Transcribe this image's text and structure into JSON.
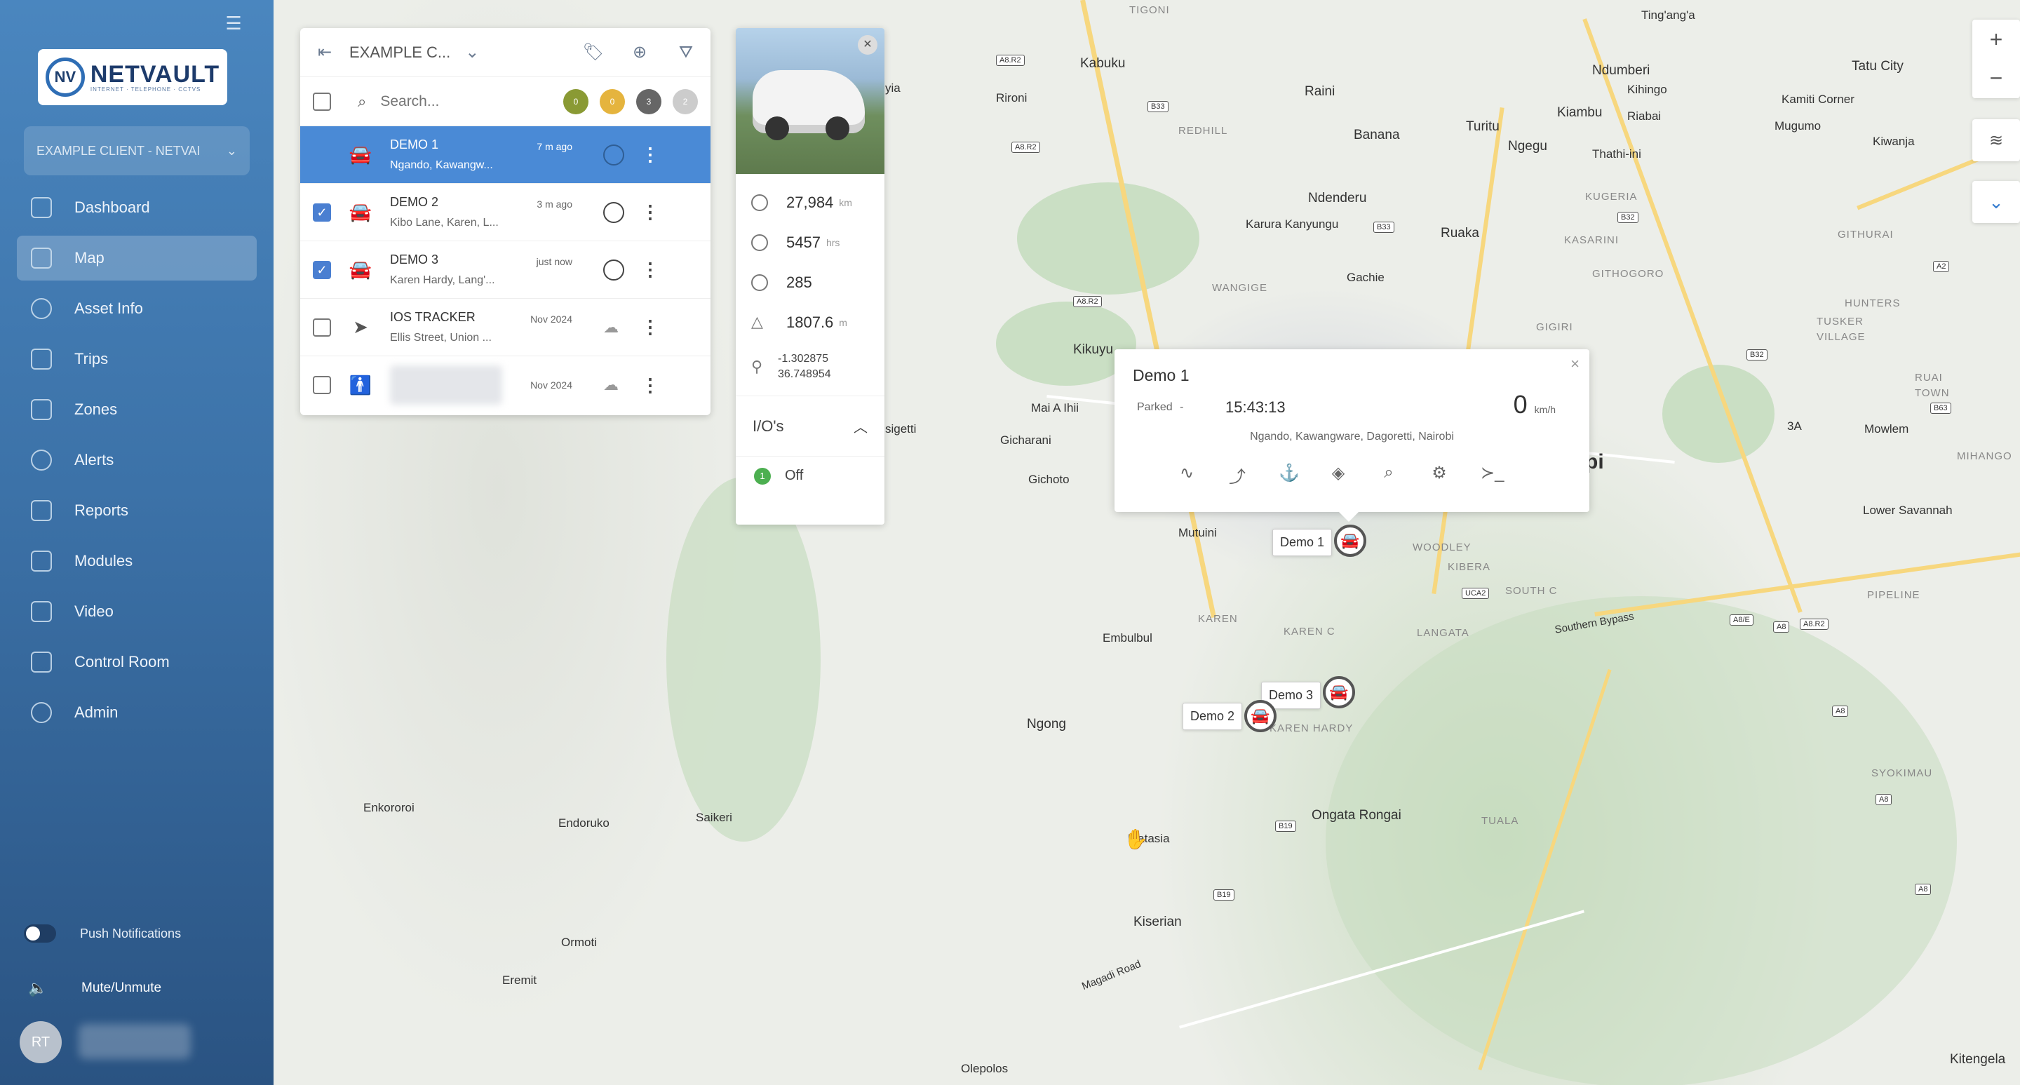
{
  "sidebar": {
    "logo_text": "NETVAULT",
    "logo_sub": "INTERNET · TELEPHONE · CCTVS",
    "client_select": "EXAMPLE CLIENT - NETVAI",
    "nav": [
      {
        "label": "Dashboard",
        "icon": "chart-line-icon"
      },
      {
        "label": "Map",
        "icon": "navigation-arrow-icon",
        "active": true
      },
      {
        "label": "Asset Info",
        "icon": "info-circle-icon"
      },
      {
        "label": "Trips",
        "icon": "route-icon"
      },
      {
        "label": "Zones",
        "icon": "zone-map-icon"
      },
      {
        "label": "Alerts",
        "icon": "bell-icon"
      },
      {
        "label": "Reports",
        "icon": "document-icon"
      },
      {
        "label": "Modules",
        "icon": "modules-icon"
      },
      {
        "label": "Video",
        "icon": "video-camera-icon"
      },
      {
        "label": "Control Room",
        "icon": "control-room-icon"
      },
      {
        "label": "Admin",
        "icon": "gear-icon"
      }
    ],
    "push_notifications": "Push Notifications",
    "mute_unmute": "Mute/Unmute",
    "avatar_initials": "RT"
  },
  "list_panel": {
    "title": "EXAMPLE C...",
    "search_placeholder": "Search...",
    "status_counts": [
      {
        "value": "0",
        "color": "#8a9a34"
      },
      {
        "value": "0",
        "color": "#e5b43e"
      },
      {
        "value": "3",
        "color": "#666666"
      },
      {
        "value": "2",
        "color": "#cccccc"
      }
    ],
    "rows": [
      {
        "name": "DEMO 1",
        "address": "Ngando, Kawangw...",
        "time": "7 m ago",
        "selected": true,
        "checked": false,
        "icon": "car-icon",
        "status": "ring"
      },
      {
        "name": "DEMO 2",
        "address": "Kibo Lane, Karen, L...",
        "time": "3 m ago",
        "selected": false,
        "checked": true,
        "icon": "car-icon",
        "status": "ring"
      },
      {
        "name": "DEMO 3",
        "address": "Karen Hardy, Lang'...",
        "time": "just now",
        "selected": false,
        "checked": true,
        "icon": "car-icon",
        "status": "ring"
      },
      {
        "name": "IOS TRACKER",
        "address": "Ellis Street, Union ...",
        "time": "Nov 2024",
        "selected": false,
        "checked": false,
        "icon": "navigation-icon",
        "status": "cloud"
      },
      {
        "name": "",
        "address": "",
        "time": "Nov 2024",
        "selected": false,
        "checked": false,
        "icon": "person-icon",
        "status": "cloud",
        "blurred": true
      }
    ]
  },
  "detail": {
    "odometer": "27,984",
    "odometer_unit": "km",
    "engine_hours": "5457",
    "engine_unit": "hrs",
    "heading": "285",
    "altitude": "1807.6",
    "altitude_unit": "m",
    "lat": "-1.302875",
    "lng": "36.748954",
    "io_title": "I/O's",
    "io_badge": "1",
    "io_value": "Off"
  },
  "popup": {
    "title": "Demo 1",
    "status": "Parked",
    "separator": "-",
    "time": "15:43:13",
    "speed": "0",
    "speed_unit": "km/h",
    "address": "Ngando, Kawangware, Dagoretti, Nairobi"
  },
  "markers": {
    "demo1": "Demo 1",
    "demo2": "Demo 2",
    "demo3": "Demo 3"
  },
  "map_labels": {
    "tigoni": "TIGONI",
    "kabuku": "Kabuku",
    "rironi": "Rironi",
    "raini": "Raini",
    "banana": "Banana",
    "ndumberi": "Ndumberi",
    "tingang": "Ting'ang'a",
    "tatu_city": "Tatu City",
    "kihingo": "Kihingo",
    "kamiti": "Kamiti Corner",
    "kiambu": "Kiambu",
    "riabai": "Riabai",
    "mugumo": "Mugumo",
    "kiwanja": "Kiwanja",
    "turitu": "Turitu",
    "ngegu": "Ngegu",
    "thathi": "Thathi-ini",
    "redhill": "REDHILL",
    "ndenderu": "Ndenderu",
    "karura": "Karura Kanyungu",
    "ruaka": "Ruaka",
    "gachie": "Gachie",
    "wangige": "WANGIGE",
    "kugeria": "KUGERIA",
    "kasarini": "KASARINI",
    "githurai": "GITHURAI",
    "gigiri": "GIGIRI",
    "githogoro": "GITHOGORO",
    "kikuyu": "Kikuyu",
    "mai_a_ihii": "Mai A Ihii",
    "gicharani": "Gicharani",
    "gichoto": "Gichoto",
    "mutuini": "Mutuini",
    "woodley": "WOODLEY",
    "kibera": "KIBERA",
    "karen": "KAREN",
    "karen_c": "KAREN C",
    "langata": "LANGATA",
    "embulbul": "Embulbul",
    "ngong": "Ngong",
    "karen_hardy": "KAREN HARDY",
    "ongata": "Ongata Rongai",
    "matasia": "Matasia",
    "kiserian": "Kiserian",
    "enkororoi": "Enkororoi",
    "endoruko": "Endoruko",
    "saikeri": "Saikeri",
    "ormoti": "Ormoti",
    "eremit": "Eremit",
    "olepolos": "Olepolos",
    "magadi": "Magadi Road",
    "mowlem": "Mowlem",
    "lower_savannah": "Lower Savannah",
    "tusker": "TUSKER VILLAGE",
    "hunters": "HUNTERS",
    "mihango": "MIHANGO",
    "pipeline": "PIPELINE",
    "south_c": "SOUTH C",
    "southern_bypass": "Southern Bypass",
    "sykimau": "SYOKIMAU",
    "tuala": "TUALA",
    "kitengela": "Kitengela",
    "sigetti": "sigetti",
    "ya": "yia",
    "pi": "pi",
    "ruai_town": "RUAI TOWN",
    "3a": "3A"
  }
}
